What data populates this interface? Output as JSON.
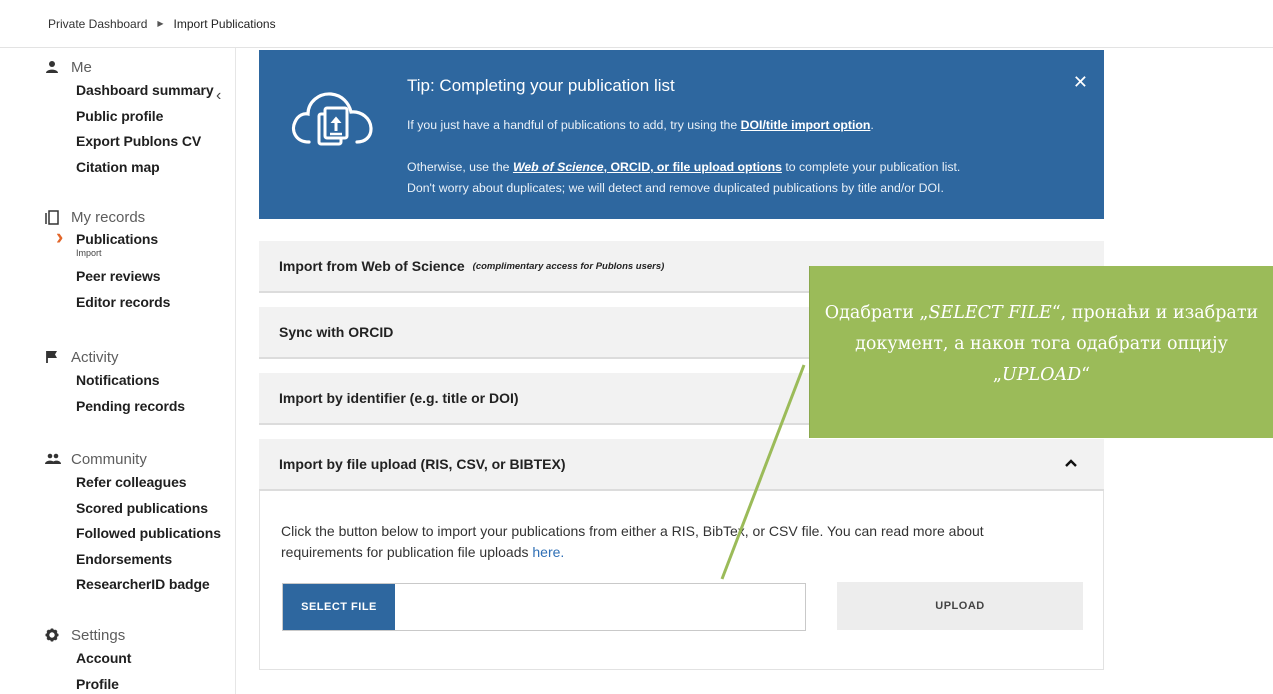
{
  "breadcrumb": {
    "parent": "Private Dashboard",
    "current": "Import Publications"
  },
  "sidebar": {
    "me": {
      "label": "Me",
      "items": [
        "Dashboard summary",
        "Public profile",
        "Export Publons CV",
        "Citation map"
      ]
    },
    "records": {
      "label": "My records",
      "active": "Publications",
      "active_sub": "Import",
      "items": [
        "Peer reviews",
        "Editor records"
      ]
    },
    "activity": {
      "label": "Activity",
      "items": [
        "Notifications",
        "Pending records"
      ]
    },
    "community": {
      "label": "Community",
      "items": [
        "Refer colleagues",
        "Scored publications",
        "Followed publications",
        "Endorsements",
        "ResearcherID badge"
      ]
    },
    "settings": {
      "label": "Settings",
      "items": [
        "Account",
        "Profile"
      ]
    }
  },
  "tip": {
    "title": "Tip:  Completing your publication list",
    "line1_pre": "If you just have a handful of publications to add, try using the ",
    "line1_link": "DOI/title import option",
    "line1_post": ".",
    "line2_pre": "Otherwise, use the ",
    "line2_link_em": "Web of Science",
    "line2_link": ", ORCID, or file upload options",
    "line2_post": " to complete your publication list.",
    "line3": "Don't worry about duplicates; we will detect and remove duplicated publications by title and/or DOI.",
    "close": "✕"
  },
  "panels": {
    "wos": {
      "title": "Import from Web of Science",
      "note": "(complimentary access for Publons users)"
    },
    "orcid": {
      "title": "Sync with ORCID"
    },
    "identifier": {
      "title": "Import by identifier (e.g. title or DOI)"
    },
    "file": {
      "title": "Import by file upload (RIS, CSV, or BIBTEX)"
    }
  },
  "file_upload": {
    "desc_pre": "Click the button below to import your publications from either a RIS, BibTex, or CSV file. You can read more about requirements for publication file uploads ",
    "desc_link": "here.",
    "select_label": "SELECT FILE",
    "upload_label": "UPLOAD"
  },
  "callout": {
    "p1": "Одабрати „",
    "p1_em": "SELECT FILE",
    "p2": "“, пронаћи и изабрати документ, а након тога одабрати опцију „",
    "p2_em": "UPLOAD",
    "p3": "“"
  },
  "colors": {
    "tip_bg": "#2e679f",
    "accent": "#e2662a",
    "callout_bg": "#9bbb59"
  },
  "icons": [
    "person-icon",
    "records-icon",
    "flag-icon",
    "community-icon",
    "gear-icon",
    "cloud-upload-icon",
    "close-icon",
    "chevron-down-icon",
    "chevron-up-icon"
  ]
}
